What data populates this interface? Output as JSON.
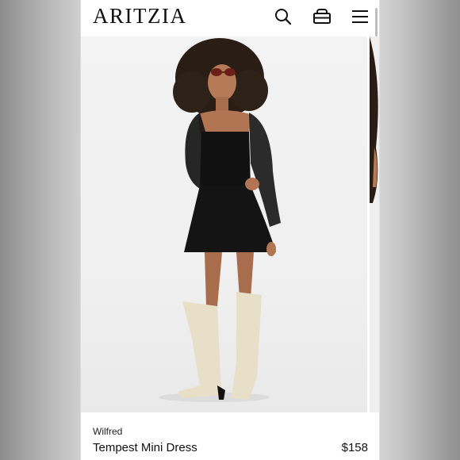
{
  "header": {
    "logo": "ARITZIA",
    "icons": [
      "search-icon",
      "bag-icon",
      "menu-icon"
    ]
  },
  "product": {
    "brand": "Wilfred",
    "name": "Tempest Mini Dress",
    "price": "$158"
  },
  "colors": {
    "page_background": "#ffffff",
    "photo_background": "#efefef",
    "text": "#111111"
  }
}
